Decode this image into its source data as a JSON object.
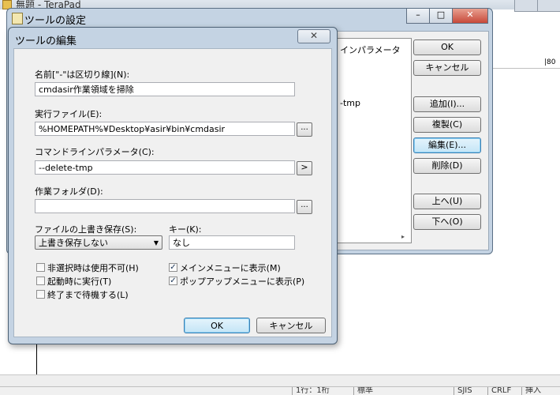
{
  "app": {
    "title": "無題 - TeraPad",
    "ruler_text": "|80",
    "status_items": [
      "1行：1桁",
      "標準",
      "SJIS",
      "CRLF",
      "挿入"
    ]
  },
  "outer_dialog": {
    "title": "ツールの設定",
    "list_header": "インパラメータ",
    "list_row": "-tmp",
    "buttons": {
      "ok": "OK",
      "cancel": "キャンセル",
      "add": "追加(I)...",
      "duplicate": "複製(C)",
      "edit": "編集(E)...",
      "delete": "削除(D)",
      "up": "上へ(U)",
      "down": "下へ(O)"
    }
  },
  "inner_dialog": {
    "title": "ツールの編集",
    "name_label": "名前[\"-\"は区切り線](N):",
    "name_value": "cmdasir作業領域を掃除",
    "exec_label": "実行ファイル(E):",
    "exec_value": "%HOMEPATH%¥Desktop¥asir¥bin¥cmdasir",
    "browse_label": "...",
    "params_label": "コマンドラインパラメータ(C):",
    "params_value": "--delete-tmp",
    "param_arrow_label": ">",
    "workdir_label": "作業フォルダ(D):",
    "workdir_value": "",
    "overwrite_label": "ファイルの上書き保存(S):",
    "overwrite_value": "上書き保存しない",
    "key_label": "キー(K):",
    "key_value": "なし",
    "checkboxes": {
      "disable_no_selection": {
        "label": "非選択時は使用不可(H)",
        "checked": false
      },
      "run_at_startup": {
        "label": "起動時に実行(T)",
        "checked": false
      },
      "wait_finish": {
        "label": "終了まで待機する(L)",
        "checked": false
      },
      "show_main_menu": {
        "label": "メインメニューに表示(M)",
        "checked": true
      },
      "show_popup_menu": {
        "label": "ポップアップメニューに表示(P)",
        "checked": true
      }
    },
    "ok": "OK",
    "cancel": "キャンセル",
    "close_glyph": "✕"
  }
}
